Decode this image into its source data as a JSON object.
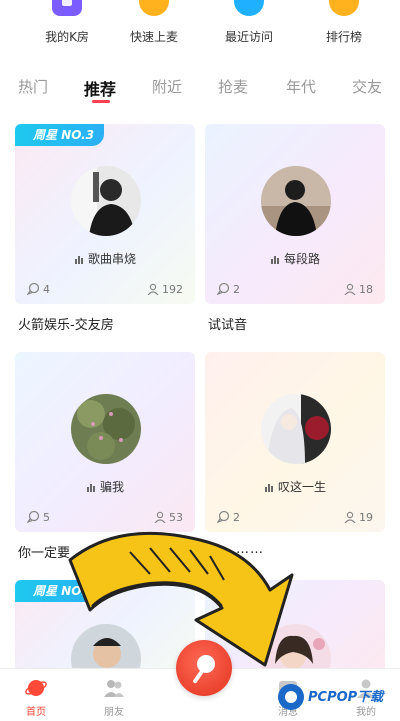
{
  "quick_actions": [
    {
      "label": "我的K房",
      "icon": "k-room-icon",
      "color": "#7b5cff"
    },
    {
      "label": "快速上麦",
      "icon": "quick-mic-icon",
      "color": "#ffb21e"
    },
    {
      "label": "最近访问",
      "icon": "recent-visit-icon",
      "color": "#1fb0ff"
    },
    {
      "label": "排行榜",
      "icon": "trophy-icon",
      "color": "#ffb21e"
    }
  ],
  "tabs": [
    "热门",
    "推荐",
    "附近",
    "抢麦",
    "年代",
    "交友"
  ],
  "active_tab": "推荐",
  "cards": [
    {
      "badge": "周星 NO.3",
      "song": "歌曲串烧",
      "comments": "4",
      "listeners": "192",
      "title": "火箭娱乐-交友房"
    },
    {
      "badge": "",
      "song": "每段路",
      "comments": "2",
      "listeners": "18",
      "title": "试试音"
    },
    {
      "badge": "",
      "song": "骗我",
      "comments": "5",
      "listeners": "53",
      "title": "你一定要"
    },
    {
      "badge": "",
      "song": "叹这一生",
      "comments": "2",
      "listeners": "19",
      "title": "…………"
    },
    {
      "badge": "周星 NO.5"
    }
  ],
  "bottom_nav": [
    {
      "label": "首页",
      "active": true
    },
    {
      "label": "朋友",
      "active": false
    },
    {
      "label": "消息",
      "active": false
    },
    {
      "label": "我的",
      "active": false
    }
  ],
  "watermark": "PCPOP下载",
  "colors": {
    "accent": "#ff4a3a",
    "badge": "#1ec8ee",
    "tab_indicator": "#ff4050"
  }
}
